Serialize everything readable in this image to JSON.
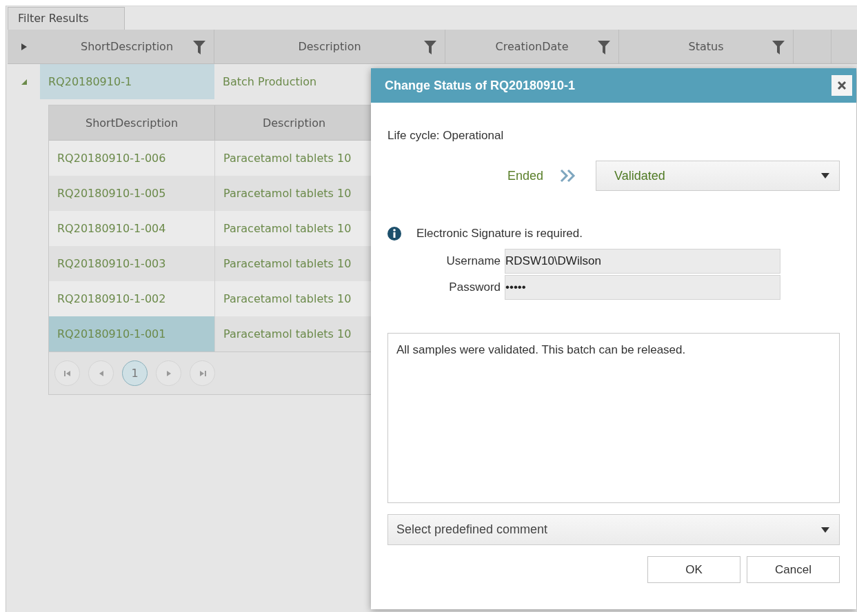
{
  "tab": {
    "label": "Filter Results",
    "selected": true
  },
  "grid": {
    "columns": [
      {
        "label": "ShortDescription",
        "filter": true
      },
      {
        "label": "Description",
        "filter": true
      },
      {
        "label": "CreationDate",
        "filter": true
      },
      {
        "label": "Status",
        "filter": true
      }
    ],
    "rows": [
      {
        "short_description": "RQ20180910-1",
        "description": "Batch Production",
        "expanded": true,
        "selected": true
      }
    ]
  },
  "detail_grid": {
    "columns": [
      "ShortDescription",
      "Description"
    ],
    "rows": [
      {
        "short_description": "RQ20180910-1-006",
        "description": "Paracetamol tablets 10",
        "selected": false
      },
      {
        "short_description": "RQ20180910-1-005",
        "description": "Paracetamol tablets 10",
        "selected": false
      },
      {
        "short_description": "RQ20180910-1-004",
        "description": "Paracetamol tablets 10",
        "selected": false
      },
      {
        "short_description": "RQ20180910-1-003",
        "description": "Paracetamol tablets 10",
        "selected": false
      },
      {
        "short_description": "RQ20180910-1-002",
        "description": "Paracetamol tablets 10",
        "selected": false
      },
      {
        "short_description": "RQ20180910-1-001",
        "description": "Paracetamol tablets 10",
        "selected": true
      }
    ],
    "pager": {
      "pages": [
        {
          "label": "1",
          "selected": true
        }
      ]
    }
  },
  "dialog": {
    "title": "Change Status of RQ20180910-1",
    "life_cycle": "Life cycle: Operational",
    "current_status": "Ended",
    "new_status": "Validated",
    "signature_note": "Electronic Signature is required.",
    "username_label": "Username",
    "username": "RDSW10\\DWilson",
    "password_label": "Password",
    "password": "•••••",
    "comment": "All samples were validated. This batch can be released.",
    "predefined_comment": {
      "placeholder": "Select predefined comment"
    },
    "buttons": [
      "OK",
      "Cancel"
    ]
  }
}
